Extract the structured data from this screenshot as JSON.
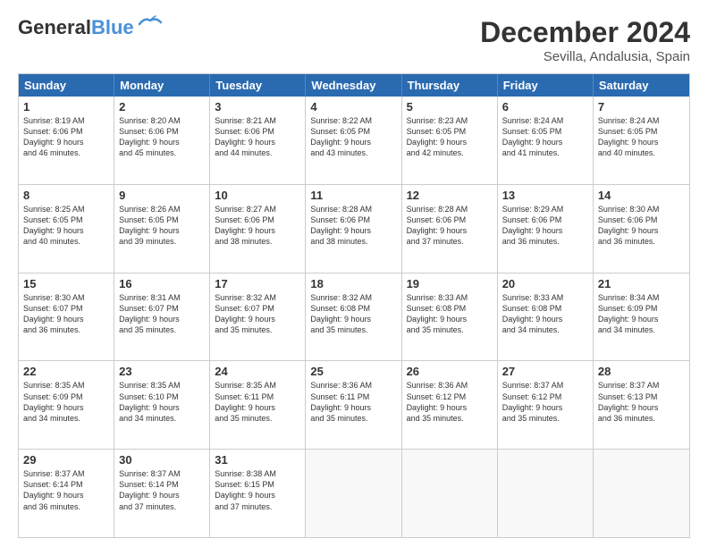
{
  "header": {
    "logo_general": "General",
    "logo_blue": "Blue",
    "month_title": "December 2024",
    "subtitle": "Sevilla, Andalusia, Spain"
  },
  "weekdays": [
    "Sunday",
    "Monday",
    "Tuesday",
    "Wednesday",
    "Thursday",
    "Friday",
    "Saturday"
  ],
  "rows": [
    [
      {
        "day": "1",
        "lines": [
          "Sunrise: 8:19 AM",
          "Sunset: 6:06 PM",
          "Daylight: 9 hours",
          "and 46 minutes."
        ]
      },
      {
        "day": "2",
        "lines": [
          "Sunrise: 8:20 AM",
          "Sunset: 6:06 PM",
          "Daylight: 9 hours",
          "and 45 minutes."
        ]
      },
      {
        "day": "3",
        "lines": [
          "Sunrise: 8:21 AM",
          "Sunset: 6:06 PM",
          "Daylight: 9 hours",
          "and 44 minutes."
        ]
      },
      {
        "day": "4",
        "lines": [
          "Sunrise: 8:22 AM",
          "Sunset: 6:05 PM",
          "Daylight: 9 hours",
          "and 43 minutes."
        ]
      },
      {
        "day": "5",
        "lines": [
          "Sunrise: 8:23 AM",
          "Sunset: 6:05 PM",
          "Daylight: 9 hours",
          "and 42 minutes."
        ]
      },
      {
        "day": "6",
        "lines": [
          "Sunrise: 8:24 AM",
          "Sunset: 6:05 PM",
          "Daylight: 9 hours",
          "and 41 minutes."
        ]
      },
      {
        "day": "7",
        "lines": [
          "Sunrise: 8:24 AM",
          "Sunset: 6:05 PM",
          "Daylight: 9 hours",
          "and 40 minutes."
        ]
      }
    ],
    [
      {
        "day": "8",
        "lines": [
          "Sunrise: 8:25 AM",
          "Sunset: 6:05 PM",
          "Daylight: 9 hours",
          "and 40 minutes."
        ]
      },
      {
        "day": "9",
        "lines": [
          "Sunrise: 8:26 AM",
          "Sunset: 6:05 PM",
          "Daylight: 9 hours",
          "and 39 minutes."
        ]
      },
      {
        "day": "10",
        "lines": [
          "Sunrise: 8:27 AM",
          "Sunset: 6:06 PM",
          "Daylight: 9 hours",
          "and 38 minutes."
        ]
      },
      {
        "day": "11",
        "lines": [
          "Sunrise: 8:28 AM",
          "Sunset: 6:06 PM",
          "Daylight: 9 hours",
          "and 38 minutes."
        ]
      },
      {
        "day": "12",
        "lines": [
          "Sunrise: 8:28 AM",
          "Sunset: 6:06 PM",
          "Daylight: 9 hours",
          "and 37 minutes."
        ]
      },
      {
        "day": "13",
        "lines": [
          "Sunrise: 8:29 AM",
          "Sunset: 6:06 PM",
          "Daylight: 9 hours",
          "and 36 minutes."
        ]
      },
      {
        "day": "14",
        "lines": [
          "Sunrise: 8:30 AM",
          "Sunset: 6:06 PM",
          "Daylight: 9 hours",
          "and 36 minutes."
        ]
      }
    ],
    [
      {
        "day": "15",
        "lines": [
          "Sunrise: 8:30 AM",
          "Sunset: 6:07 PM",
          "Daylight: 9 hours",
          "and 36 minutes."
        ]
      },
      {
        "day": "16",
        "lines": [
          "Sunrise: 8:31 AM",
          "Sunset: 6:07 PM",
          "Daylight: 9 hours",
          "and 35 minutes."
        ]
      },
      {
        "day": "17",
        "lines": [
          "Sunrise: 8:32 AM",
          "Sunset: 6:07 PM",
          "Daylight: 9 hours",
          "and 35 minutes."
        ]
      },
      {
        "day": "18",
        "lines": [
          "Sunrise: 8:32 AM",
          "Sunset: 6:08 PM",
          "Daylight: 9 hours",
          "and 35 minutes."
        ]
      },
      {
        "day": "19",
        "lines": [
          "Sunrise: 8:33 AM",
          "Sunset: 6:08 PM",
          "Daylight: 9 hours",
          "and 35 minutes."
        ]
      },
      {
        "day": "20",
        "lines": [
          "Sunrise: 8:33 AM",
          "Sunset: 6:08 PM",
          "Daylight: 9 hours",
          "and 34 minutes."
        ]
      },
      {
        "day": "21",
        "lines": [
          "Sunrise: 8:34 AM",
          "Sunset: 6:09 PM",
          "Daylight: 9 hours",
          "and 34 minutes."
        ]
      }
    ],
    [
      {
        "day": "22",
        "lines": [
          "Sunrise: 8:35 AM",
          "Sunset: 6:09 PM",
          "Daylight: 9 hours",
          "and 34 minutes."
        ]
      },
      {
        "day": "23",
        "lines": [
          "Sunrise: 8:35 AM",
          "Sunset: 6:10 PM",
          "Daylight: 9 hours",
          "and 34 minutes."
        ]
      },
      {
        "day": "24",
        "lines": [
          "Sunrise: 8:35 AM",
          "Sunset: 6:11 PM",
          "Daylight: 9 hours",
          "and 35 minutes."
        ]
      },
      {
        "day": "25",
        "lines": [
          "Sunrise: 8:36 AM",
          "Sunset: 6:11 PM",
          "Daylight: 9 hours",
          "and 35 minutes."
        ]
      },
      {
        "day": "26",
        "lines": [
          "Sunrise: 8:36 AM",
          "Sunset: 6:12 PM",
          "Daylight: 9 hours",
          "and 35 minutes."
        ]
      },
      {
        "day": "27",
        "lines": [
          "Sunrise: 8:37 AM",
          "Sunset: 6:12 PM",
          "Daylight: 9 hours",
          "and 35 minutes."
        ]
      },
      {
        "day": "28",
        "lines": [
          "Sunrise: 8:37 AM",
          "Sunset: 6:13 PM",
          "Daylight: 9 hours",
          "and 36 minutes."
        ]
      }
    ],
    [
      {
        "day": "29",
        "lines": [
          "Sunrise: 8:37 AM",
          "Sunset: 6:14 PM",
          "Daylight: 9 hours",
          "and 36 minutes."
        ]
      },
      {
        "day": "30",
        "lines": [
          "Sunrise: 8:37 AM",
          "Sunset: 6:14 PM",
          "Daylight: 9 hours",
          "and 37 minutes."
        ]
      },
      {
        "day": "31",
        "lines": [
          "Sunrise: 8:38 AM",
          "Sunset: 6:15 PM",
          "Daylight: 9 hours",
          "and 37 minutes."
        ]
      },
      {
        "day": "",
        "lines": []
      },
      {
        "day": "",
        "lines": []
      },
      {
        "day": "",
        "lines": []
      },
      {
        "day": "",
        "lines": []
      }
    ]
  ]
}
